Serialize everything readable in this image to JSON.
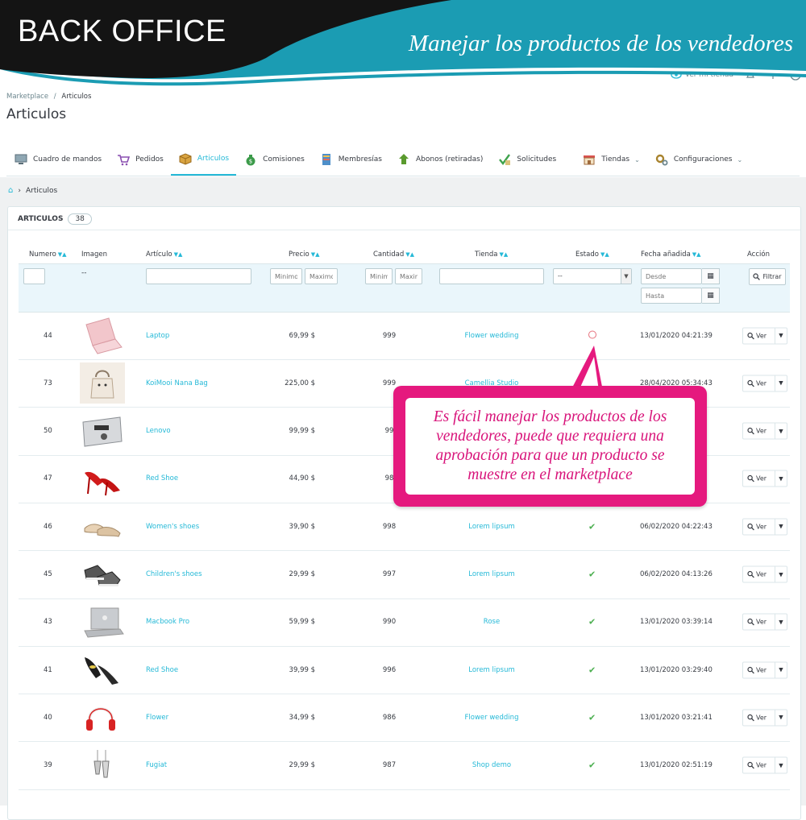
{
  "banner": {
    "title": "BACK OFFICE",
    "subtitle": "Manejar los productos de los vendedores",
    "colors": {
      "dark": "#1a1a1a",
      "teal": "#1b9cb3"
    }
  },
  "header": {
    "view_store": "Ver mi tienda"
  },
  "breadcrumb": {
    "parent": "Marketplace",
    "separator": "/",
    "current": "Articulos"
  },
  "page_title": "Articulos",
  "tabs": [
    {
      "label": "Cuadro de mandos",
      "icon": "dashboard-icon"
    },
    {
      "label": "Pedidos",
      "icon": "cart-icon"
    },
    {
      "label": "Articulos",
      "icon": "box-icon",
      "active": true
    },
    {
      "label": "Comisiones",
      "icon": "money-bag-icon"
    },
    {
      "label": "Membresías",
      "icon": "book-icon"
    },
    {
      "label": "Abonos (retiradas)",
      "icon": "withdraw-icon"
    },
    {
      "label": "Solicitudes",
      "icon": "checklist-icon"
    },
    {
      "label": "Tiendas",
      "icon": "store-icon",
      "dropdown": true
    },
    {
      "label": "Configuraciones",
      "icon": "gears-icon",
      "dropdown": true
    }
  ],
  "sub_breadcrumb": {
    "current": "Articulos"
  },
  "panel": {
    "title": "ARTICULOS",
    "count": "38"
  },
  "columns": {
    "numero": "Numero",
    "imagen": "Imagen",
    "articulo": "Artículo",
    "precio": "Precio",
    "cantidad": "Cantidad",
    "tienda": "Tienda",
    "estado": "Estado",
    "fecha": "Fecha añadida",
    "accion": "Acción"
  },
  "filters": {
    "imagen_value": "--",
    "price_min_placeholder": "Minimo",
    "price_max_placeholder": "Maximo",
    "qty_min_placeholder": "Minimo",
    "qty_max_placeholder": "Maximo",
    "estado_value": "--",
    "date_from_placeholder": "Desde",
    "date_to_placeholder": "Hasta",
    "filter_button": "Filtrar"
  },
  "rows": [
    {
      "id": "44",
      "name": "Laptop",
      "price": "69,99 $",
      "qty": "999",
      "store": "Flower wedding",
      "status": "pending",
      "date": "13/01/2020 04:21:39",
      "action": "Ver",
      "img": "laptop"
    },
    {
      "id": "73",
      "name": "KoiMooi Nana Bag",
      "price": "225,00 $",
      "qty": "999",
      "store": "Camellia Studio",
      "status": "approved",
      "date": "28/04/2020 05:34:43",
      "action": "Ver",
      "img": "bag"
    },
    {
      "id": "50",
      "name": "Lenovo",
      "price": "99,99 $",
      "qty": "99",
      "store": "",
      "status": "",
      "date": "",
      "action": "Ver",
      "img": "lenovo"
    },
    {
      "id": "47",
      "name": "Red Shoe",
      "price": "44,90 $",
      "qty": "98",
      "store": "",
      "status": "",
      "date": "",
      "action": "Ver",
      "img": "redshoe"
    },
    {
      "id": "46",
      "name": "Women's shoes",
      "price": "39,90 $",
      "qty": "998",
      "store": "Lorem lipsum",
      "status": "approved",
      "date": "06/02/2020 04:22:43",
      "action": "Ver",
      "img": "womenshoe"
    },
    {
      "id": "45",
      "name": "Children's shoes",
      "price": "29,99 $",
      "qty": "997",
      "store": "Lorem lipsum",
      "status": "approved",
      "date": "06/02/2020 04:13:26",
      "action": "Ver",
      "img": "sneaker"
    },
    {
      "id": "43",
      "name": "Macbook Pro",
      "price": "59,99 $",
      "qty": "990",
      "store": "Rose",
      "status": "approved",
      "date": "13/01/2020 03:39:14",
      "action": "Ver",
      "img": "macbook"
    },
    {
      "id": "41",
      "name": "Red Shoe",
      "price": "39,99 $",
      "qty": "996",
      "store": "Lorem lipsum",
      "status": "approved",
      "date": "13/01/2020 03:29:40",
      "action": "Ver",
      "img": "heels"
    },
    {
      "id": "40",
      "name": "Flower",
      "price": "34,99 $",
      "qty": "986",
      "store": "Flower wedding",
      "status": "approved",
      "date": "13/01/2020 03:21:41",
      "action": "Ver",
      "img": "headphones"
    },
    {
      "id": "39",
      "name": "Fugiat",
      "price": "29,99 $",
      "qty": "987",
      "store": "Shop demo",
      "status": "approved",
      "date": "13/01/2020 02:51:19",
      "action": "Ver",
      "img": "earrings"
    }
  ],
  "callout": {
    "text": "Es fácil manejar los productos de los vendedores, puede que requiera una aprobación para que un producto se muestre en el marketplace",
    "color": "#e5197e"
  }
}
